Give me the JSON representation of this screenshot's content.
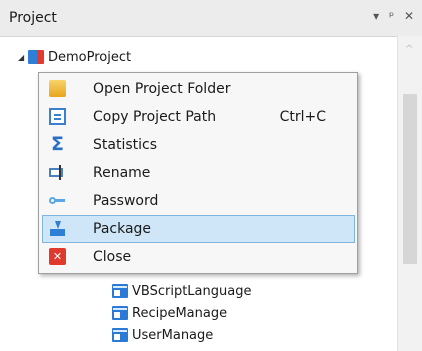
{
  "panel": {
    "title": "Project",
    "header_icons": {
      "dropdown": "▾",
      "pin": "ᵖ",
      "close": "✕"
    }
  },
  "tree": {
    "root": {
      "expander": "◢",
      "label": "DemoProject",
      "icon": "project-icon"
    },
    "children": [
      {
        "label": "VBScriptLanguage",
        "icon": "list-icon"
      },
      {
        "label": "RecipeManage",
        "icon": "list-icon"
      },
      {
        "label": "UserManage",
        "icon": "list-icon"
      }
    ]
  },
  "scrollbar": {
    "up_arrow": "^"
  },
  "context_menu": {
    "items": [
      {
        "label": "Open Project Folder",
        "shortcut": "",
        "icon": "folder-open-icon"
      },
      {
        "label": "Copy Project Path",
        "shortcut": "Ctrl+C",
        "icon": "copy-icon"
      },
      {
        "label": "Statistics",
        "shortcut": "",
        "icon": "sigma-icon",
        "glyph": "Σ"
      },
      {
        "label": "Rename",
        "shortcut": "",
        "icon": "rename-icon"
      },
      {
        "label": "Password",
        "shortcut": "",
        "icon": "key-icon"
      },
      {
        "label": "Package",
        "shortcut": "",
        "icon": "package-icon",
        "highlighted": true
      },
      {
        "label": "Close",
        "shortcut": "",
        "icon": "close-icon",
        "glyph": "✕"
      }
    ]
  },
  "colors": {
    "menu_highlight": "#cfe6f8",
    "menu_highlight_border": "#7fb4dc",
    "header_bg": "#ececec"
  }
}
